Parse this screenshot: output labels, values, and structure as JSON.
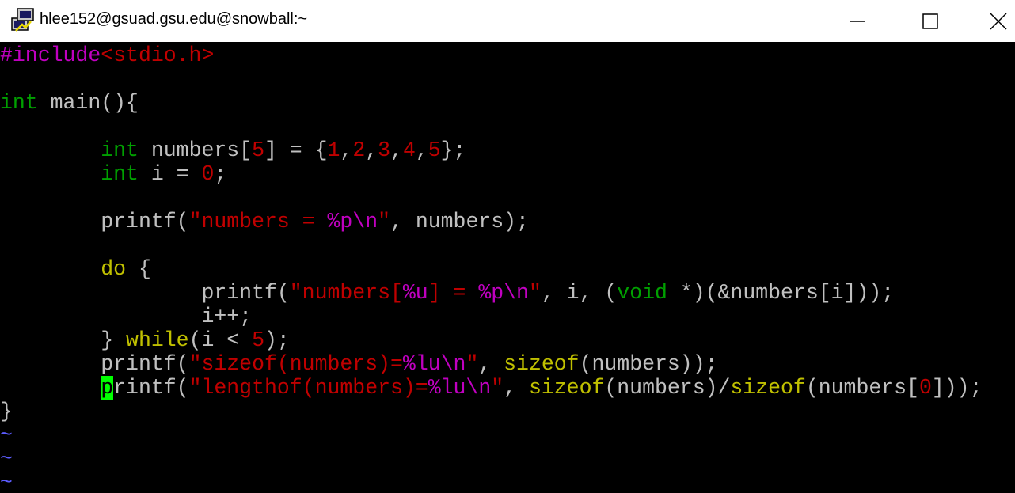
{
  "window": {
    "title": "hlee152@gsuad.gsu.edu@snowball:~"
  },
  "colors": {
    "default": "#c0c0c0",
    "preproc": "#c000c0",
    "type": "#00a000",
    "number": "#c00000",
    "string": "#c00000",
    "special": "#c000c0",
    "statement": "#c0c000",
    "tilde": "#5c5cff",
    "cursor": "#00ff00"
  },
  "code": {
    "lines": [
      {
        "indent": 0,
        "tokens": [
          {
            "text": "#include",
            "color": "#c000c0"
          },
          {
            "text": "<stdio.h>",
            "color": "#c00000"
          }
        ]
      },
      {
        "indent": 0,
        "tokens": []
      },
      {
        "indent": 0,
        "tokens": [
          {
            "text": "int",
            "color": "#00a000"
          },
          {
            "text": " main(){",
            "color": "#c0c0c0"
          }
        ]
      },
      {
        "indent": 0,
        "tokens": []
      },
      {
        "indent": 8,
        "tokens": [
          {
            "text": "int",
            "color": "#00a000"
          },
          {
            "text": " numbers[",
            "color": "#c0c0c0"
          },
          {
            "text": "5",
            "color": "#c00000"
          },
          {
            "text": "] = {",
            "color": "#c0c0c0"
          },
          {
            "text": "1",
            "color": "#c00000"
          },
          {
            "text": ",",
            "color": "#c0c0c0"
          },
          {
            "text": "2",
            "color": "#c00000"
          },
          {
            "text": ",",
            "color": "#c0c0c0"
          },
          {
            "text": "3",
            "color": "#c00000"
          },
          {
            "text": ",",
            "color": "#c0c0c0"
          },
          {
            "text": "4",
            "color": "#c00000"
          },
          {
            "text": ",",
            "color": "#c0c0c0"
          },
          {
            "text": "5",
            "color": "#c00000"
          },
          {
            "text": "};",
            "color": "#c0c0c0"
          }
        ]
      },
      {
        "indent": 8,
        "tokens": [
          {
            "text": "int",
            "color": "#00a000"
          },
          {
            "text": " i = ",
            "color": "#c0c0c0"
          },
          {
            "text": "0",
            "color": "#c00000"
          },
          {
            "text": ";",
            "color": "#c0c0c0"
          }
        ]
      },
      {
        "indent": 0,
        "tokens": []
      },
      {
        "indent": 8,
        "tokens": [
          {
            "text": "printf(",
            "color": "#c0c0c0"
          },
          {
            "text": "\"numbers = ",
            "color": "#c00000"
          },
          {
            "text": "%p\\n",
            "color": "#c000c0"
          },
          {
            "text": "\"",
            "color": "#c00000"
          },
          {
            "text": ", numbers);",
            "color": "#c0c0c0"
          }
        ]
      },
      {
        "indent": 0,
        "tokens": []
      },
      {
        "indent": 8,
        "tokens": [
          {
            "text": "do",
            "color": "#c0c000"
          },
          {
            "text": " {",
            "color": "#c0c0c0"
          }
        ]
      },
      {
        "indent": 16,
        "tokens": [
          {
            "text": "printf(",
            "color": "#c0c0c0"
          },
          {
            "text": "\"numbers[",
            "color": "#c00000"
          },
          {
            "text": "%u",
            "color": "#c000c0"
          },
          {
            "text": "] = ",
            "color": "#c00000"
          },
          {
            "text": "%p\\n",
            "color": "#c000c0"
          },
          {
            "text": "\"",
            "color": "#c00000"
          },
          {
            "text": ", i, (",
            "color": "#c0c0c0"
          },
          {
            "text": "void",
            "color": "#00a000"
          },
          {
            "text": " *)(&numbers[i]));",
            "color": "#c0c0c0"
          }
        ]
      },
      {
        "indent": 16,
        "tokens": [
          {
            "text": "i++;",
            "color": "#c0c0c0"
          }
        ]
      },
      {
        "indent": 8,
        "tokens": [
          {
            "text": "} ",
            "color": "#c0c0c0"
          },
          {
            "text": "while",
            "color": "#c0c000"
          },
          {
            "text": "(i < ",
            "color": "#c0c0c0"
          },
          {
            "text": "5",
            "color": "#c00000"
          },
          {
            "text": ");",
            "color": "#c0c0c0"
          }
        ]
      },
      {
        "indent": 8,
        "tokens": [
          {
            "text": "printf(",
            "color": "#c0c0c0"
          },
          {
            "text": "\"sizeof(numbers)=",
            "color": "#c00000"
          },
          {
            "text": "%lu\\n",
            "color": "#c000c0"
          },
          {
            "text": "\"",
            "color": "#c00000"
          },
          {
            "text": ", ",
            "color": "#c0c0c0"
          },
          {
            "text": "sizeof",
            "color": "#c0c000"
          },
          {
            "text": "(numbers));",
            "color": "#c0c0c0"
          }
        ]
      },
      {
        "indent": 8,
        "tokens": [
          {
            "text": "p",
            "color": "#000000",
            "cursor": true
          },
          {
            "text": "rintf(",
            "color": "#c0c0c0"
          },
          {
            "text": "\"lengthof(numbers)=",
            "color": "#c00000"
          },
          {
            "text": "%lu\\n",
            "color": "#c000c0"
          },
          {
            "text": "\"",
            "color": "#c00000"
          },
          {
            "text": ", ",
            "color": "#c0c0c0"
          },
          {
            "text": "sizeof",
            "color": "#c0c000"
          },
          {
            "text": "(numbers)/",
            "color": "#c0c0c0"
          },
          {
            "text": "sizeof",
            "color": "#c0c000"
          },
          {
            "text": "(numbers[",
            "color": "#c0c0c0"
          },
          {
            "text": "0",
            "color": "#c00000"
          },
          {
            "text": "]));",
            "color": "#c0c0c0"
          }
        ]
      },
      {
        "indent": 0,
        "tokens": [
          {
            "text": "}",
            "color": "#c0c0c0"
          }
        ]
      }
    ],
    "tildes": [
      "~",
      "~",
      "~"
    ]
  }
}
